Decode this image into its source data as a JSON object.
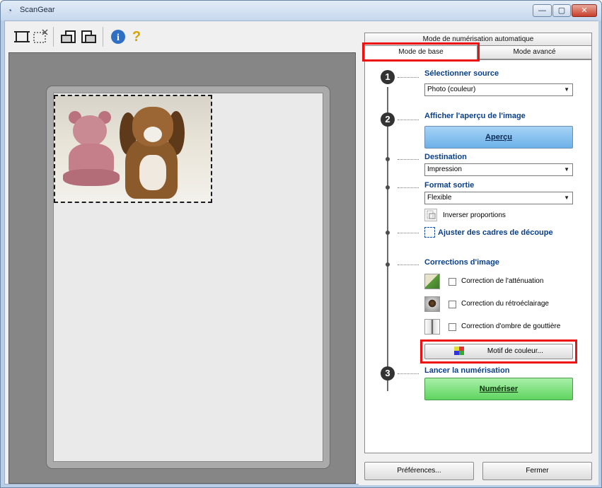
{
  "window": {
    "title": "ScanGear",
    "min_glyph": "—",
    "max_glyph": "▢",
    "close_glyph": "✕"
  },
  "toolbar": {
    "icons": [
      "auto-crop-icon",
      "remove-crop-icon",
      "rotate-left-icon",
      "rotate-right-icon",
      "info-icon",
      "help-icon"
    ],
    "help_glyph": "?",
    "info_glyph": "i"
  },
  "tabs": {
    "auto": "Mode de numérisation automatique",
    "basic": "Mode de base",
    "advanced": "Mode avancé"
  },
  "steps": {
    "one": "1",
    "two": "2",
    "three": "3"
  },
  "source": {
    "heading": "Sélectionner source",
    "value": "Photo (couleur)"
  },
  "preview": {
    "heading": "Afficher l'aperçu de l'image",
    "button": "Aperçu"
  },
  "destination": {
    "heading": "Destination",
    "value": "Impression"
  },
  "output_size": {
    "heading": "Format sortie",
    "value": "Flexible",
    "swap_label": "Inverser proportions"
  },
  "crop": {
    "heading": "Ajuster des cadres de découpe"
  },
  "corrections": {
    "heading": "Corrections d'image",
    "items": [
      {
        "label": "Correction de l'atténuation",
        "checked": false
      },
      {
        "label": "Correction du rétroéclairage",
        "checked": false
      },
      {
        "label": "Correction d'ombre de gouttière",
        "checked": false
      }
    ],
    "color_pattern_button": "Motif de couleur..."
  },
  "scan": {
    "heading": "Lancer la numérisation",
    "button": "Numériser"
  },
  "footer": {
    "preferences": "Préférences...",
    "close": "Fermer"
  },
  "colors": {
    "highlight": "#ee1111",
    "preview_button": "#6cb1e8",
    "scan_button": "#5fd45f",
    "heading_text": "#0a3f8a"
  }
}
